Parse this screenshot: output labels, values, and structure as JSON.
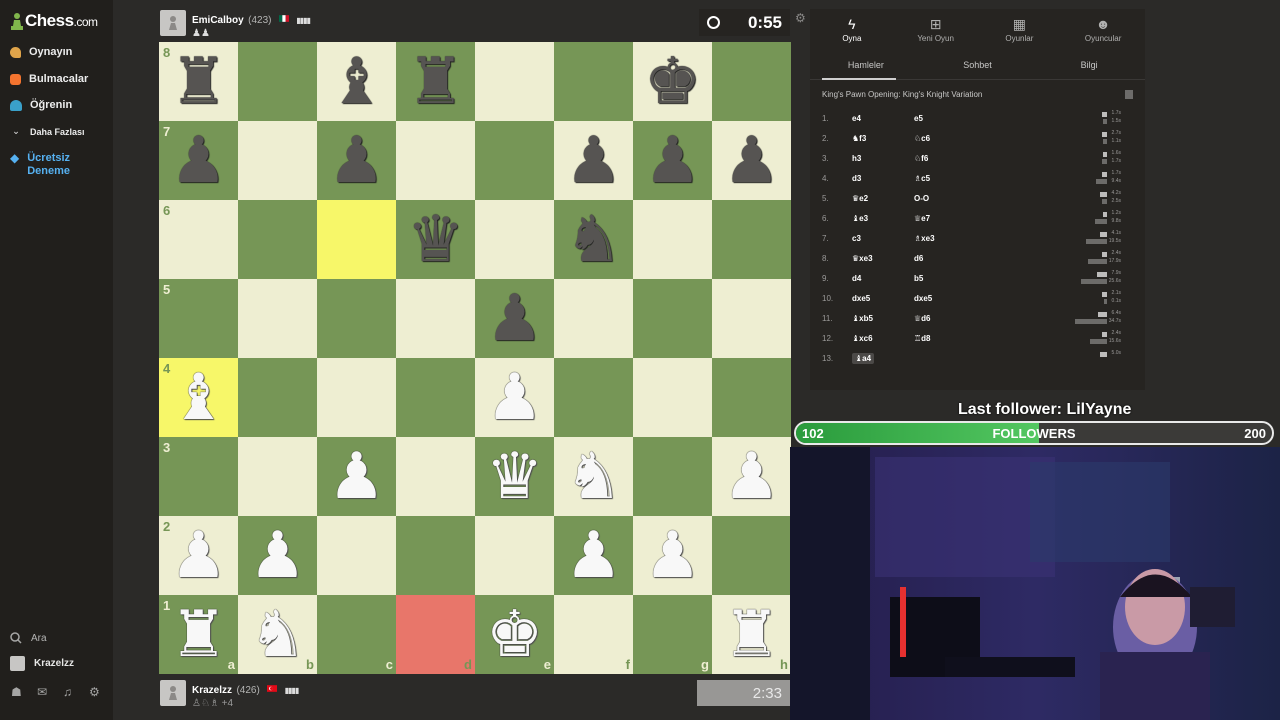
{
  "app": {
    "logo_text": "Chess",
    "logo_suffix": ".com"
  },
  "sidebar": {
    "items": [
      {
        "label": "Oynayın",
        "icon": "play-hand-icon"
      },
      {
        "label": "Bulmacalar",
        "icon": "puzzle-icon"
      },
      {
        "label": "Öğrenin",
        "icon": "learn-cap-icon"
      },
      {
        "label": "Daha Fazlası",
        "icon": "chevron-down-icon"
      }
    ],
    "trial_line1": "Ücretsiz",
    "trial_line2": "Deneme",
    "search_label": "Ara",
    "user_label": "Krazelzz"
  },
  "top_player": {
    "name": "EmiCalboy",
    "rating": "(423)",
    "bars": "▮▮▮▮",
    "captured": "♟♟",
    "clock": "0:55"
  },
  "bottom_player": {
    "name": "Krazelzz",
    "rating": "(426)",
    "bars": "▮▮▮▮",
    "captured": "♙♘♗ +4",
    "clock": "2:33"
  },
  "board": {
    "ranks": [
      "8",
      "7",
      "6",
      "5",
      "4",
      "3",
      "2",
      "1"
    ],
    "files": [
      "a",
      "b",
      "c",
      "d",
      "e",
      "f",
      "g",
      "h"
    ],
    "position": [
      [
        "r",
        "",
        "b",
        "r",
        "",
        "",
        "k",
        ""
      ],
      [
        "p",
        "",
        "p",
        "",
        "",
        "p",
        "p",
        "p"
      ],
      [
        "",
        "",
        "",
        "q",
        "",
        "n",
        "",
        ""
      ],
      [
        "",
        "",
        "",
        "",
        "p",
        "",
        "",
        ""
      ],
      [
        "B",
        "",
        "",
        "",
        "P",
        "",
        "",
        ""
      ],
      [
        "",
        "",
        "P",
        "",
        "Q",
        "N",
        "",
        "P"
      ],
      [
        "P",
        "P",
        "",
        "",
        "",
        "P",
        "P",
        ""
      ],
      [
        "R",
        "N",
        "",
        "",
        "K",
        "",
        "",
        "R"
      ]
    ],
    "highlight_yellow": [
      "c6",
      "a4"
    ],
    "highlight_red": [
      "d1"
    ]
  },
  "panel": {
    "tabs": [
      {
        "label": "Oyna",
        "icon": "lightning-icon"
      },
      {
        "label": "Yeni Oyun",
        "icon": "plus-square-icon"
      },
      {
        "label": "Oyunlar",
        "icon": "board-grid-icon"
      },
      {
        "label": "Oyuncular",
        "icon": "players-icon"
      }
    ],
    "subtabs": [
      "Hamleler",
      "Sohbet",
      "Bilgi"
    ],
    "opening": "King's Pawn Opening: King's Knight Variation",
    "moves": [
      {
        "n": "1.",
        "w": "e4",
        "b": "e5",
        "tw": "1.7s",
        "tb": "1.5s"
      },
      {
        "n": "2.",
        "w": "♞f3",
        "b": "♘c6",
        "tw": "2.7s",
        "tb": "1.1s"
      },
      {
        "n": "3.",
        "w": "h3",
        "b": "♘f6",
        "tw": "1.6s",
        "tb": "1.7s"
      },
      {
        "n": "4.",
        "w": "d3",
        "b": "♗c5",
        "tw": "1.7s",
        "tb": "9.4s"
      },
      {
        "n": "5.",
        "w": "♛e2",
        "b": "O-O",
        "tw": "4.2s",
        "tb": "2.5s"
      },
      {
        "n": "6.",
        "w": "♝e3",
        "b": "♕e7",
        "tw": "1.2s",
        "tb": "9.8s"
      },
      {
        "n": "7.",
        "w": "c3",
        "b": "♗xe3",
        "tw": "4.1s",
        "tb": "19.5s"
      },
      {
        "n": "8.",
        "w": "♛xe3",
        "b": "d6",
        "tw": "2.4s",
        "tb": "17.9s"
      },
      {
        "n": "9.",
        "w": "d4",
        "b": "b5",
        "tw": "7.9s",
        "tb": "25.6s"
      },
      {
        "n": "10.",
        "w": "dxe5",
        "b": "dxe5",
        "tw": "2.1s",
        "tb": "0.1s"
      },
      {
        "n": "11.",
        "w": "♝xb5",
        "b": "♕d6",
        "tw": "6.4s",
        "tb": "34.7s"
      },
      {
        "n": "12.",
        "w": "♝xc6",
        "b": "♖d8",
        "tw": "2.4s",
        "tb": "15.6s"
      },
      {
        "n": "13.",
        "w": "♝a4",
        "b": "",
        "tw": "5.0s",
        "tb": ""
      }
    ]
  },
  "stream": {
    "last_follower": "Last follower: LilYayne",
    "followers_label": "FOLLOWERS",
    "current": "102",
    "goal": "200",
    "progress": 0.51
  },
  "colors": {
    "board_light": "#eeeed2",
    "board_dark": "#769656",
    "highlight": "#f7f769",
    "check_red": "#e8766a",
    "follow_green": "#53c761"
  }
}
